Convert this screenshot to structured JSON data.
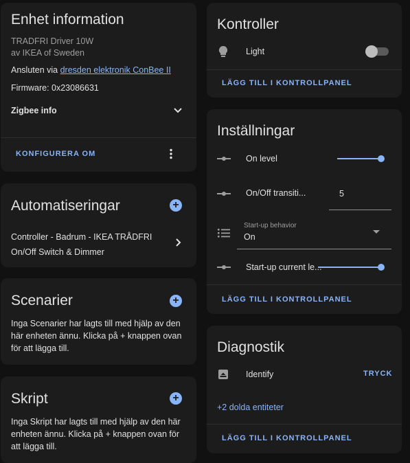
{
  "device": {
    "title": "Enhet information",
    "model": "TRADFRI Driver 10W",
    "manufacturer": "av IKEA of Sweden",
    "connected_prefix": "Ansluten via",
    "connected_link": "dresden elektronik ConBee II",
    "firmware": "Firmware: 0x23086631",
    "zigbee_info": "Zigbee info",
    "reconfigure": "KONFIGURERA OM"
  },
  "automations": {
    "title": "Automatiseringar",
    "item_line1": "Controller - Badrum - IKEA TRÅDFRI",
    "item_line2": "On/Off Switch & Dimmer"
  },
  "scenes": {
    "title": "Scenarier",
    "line1": "Inga Scenarier har lagts till med hjälp av den",
    "line2": "här enheten ännu. Klicka på + knappen ovan",
    "line3": "för att lägga till."
  },
  "scripts": {
    "title": "Skript",
    "line1": "Inga Skript har lagts till med hjälp av den här",
    "line2": "enheten ännu. Klicka på + knappen ovan för",
    "line3": "att lägga till."
  },
  "controls": {
    "title": "Kontroller",
    "light_label": "Light",
    "light_on": false,
    "add_dashboard": "LÄGG TILL I KONTROLLPANEL"
  },
  "settings": {
    "title": "Inställningar",
    "on_level": "On level",
    "on_level_value": 1.0,
    "onoff_transition": "On/Off transiti...",
    "onoff_transition_value": "5",
    "startup_behavior_label": "Start-up behavior",
    "startup_behavior_value": "On",
    "startup_current_level": "Start-up current le...",
    "startup_current_level_value": 1.0,
    "add_dashboard": "LÄGG TILL I KONTROLLPANEL"
  },
  "diagnostics": {
    "title": "Diagnostik",
    "identify": "Identify",
    "press": "TRYCK",
    "hidden_entities": "+2 dolda entiteter",
    "add_dashboard": "LÄGG TILL I KONTROLLPANEL"
  },
  "colors": {
    "accent": "#8ab4f8",
    "card": "#1c1c1c",
    "background": "#111111"
  }
}
